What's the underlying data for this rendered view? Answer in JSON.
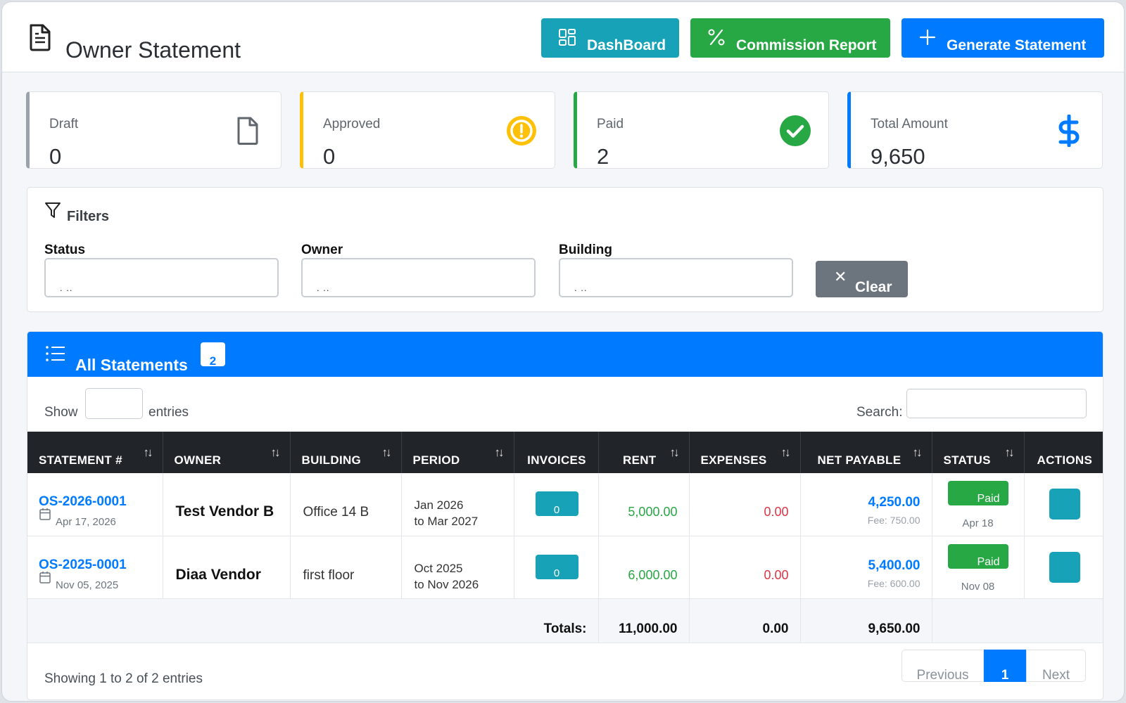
{
  "header": {
    "title": "Owner Statement",
    "buttons": {
      "dashboard": "DashBoard",
      "commission": "Commission Report",
      "generate": "Generate Statement"
    }
  },
  "stats": {
    "draft": {
      "label": "Draft",
      "value": "0"
    },
    "approved": {
      "label": "Approved",
      "value": "0"
    },
    "paid": {
      "label": "Paid",
      "value": "2"
    },
    "total": {
      "label": "Total Amount",
      "value": "9,650"
    }
  },
  "filters": {
    "title": "Filters",
    "status_label": "Status",
    "owner_label": "Owner",
    "building_label": "Building",
    "select_placeholder": ". ..",
    "clear": "Clear"
  },
  "statements": {
    "title": "All Statements",
    "count": "2",
    "show_label": "Show",
    "entries_label": "entries",
    "search_label": "Search:",
    "columns": [
      "STATEMENT #",
      "OWNER",
      "BUILDING",
      "PERIOD",
      "INVOICES",
      "RENT",
      "EXPENSES",
      "NET PAYABLE",
      "STATUS",
      "ACTIONS"
    ],
    "rows": [
      {
        "number": "OS-2026-0001",
        "date": "Apr 17, 2026",
        "owner": "Test Vendor B",
        "building": "Office 14 B",
        "period_from": "Jan 2026",
        "period_to": "to Mar 2027",
        "invoices": "0",
        "rent": "5,000.00",
        "expenses": "0.00",
        "net": "4,250.00",
        "fee": "Fee: 750.00",
        "status": "Paid",
        "status_date": "Apr 18"
      },
      {
        "number": "OS-2025-0001",
        "date": "Nov 05, 2025",
        "owner": "Diaa Vendor",
        "building": "first floor",
        "period_from": "Oct 2025",
        "period_to": "to Nov 2026",
        "invoices": "0",
        "rent": "6,000.00",
        "expenses": "0.00",
        "net": "5,400.00",
        "fee": "Fee: 600.00",
        "status": "Paid",
        "status_date": "Nov 08"
      }
    ],
    "totals": {
      "label": "Totals:",
      "rent": "11,000.00",
      "expenses": "0.00",
      "net": "9,650.00"
    },
    "showing": "Showing 1 to 2 of 2 entries",
    "pagination": {
      "previous": "Previous",
      "current": "1",
      "next": "Next"
    }
  },
  "colors": {
    "primary": "#007bff",
    "info": "#17a2b8",
    "success": "#28a745",
    "warning": "#ffc107",
    "danger": "#dc3545",
    "secondary": "#6c757d",
    "dark": "#212529"
  }
}
